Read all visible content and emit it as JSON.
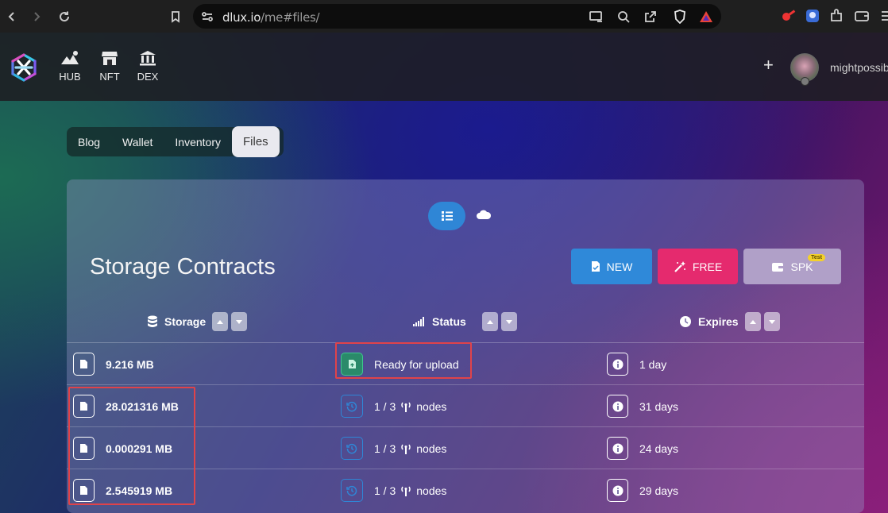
{
  "browser": {
    "url_host": "dlux.io",
    "url_path": "/me#files/"
  },
  "header": {
    "nav": [
      {
        "label": "HUB",
        "icon": "mountain-icon"
      },
      {
        "label": "NFT",
        "icon": "store-icon"
      },
      {
        "label": "DEX",
        "icon": "bank-icon"
      }
    ],
    "username": "mightpossibl"
  },
  "tabs": [
    {
      "label": "Blog",
      "active": false
    },
    {
      "label": "Wallet",
      "active": false
    },
    {
      "label": "Inventory",
      "active": false
    },
    {
      "label": "Files",
      "active": true
    }
  ],
  "card": {
    "title": "Storage Contracts",
    "buttons": {
      "new": "NEW",
      "free": "FREE",
      "spk": "SPK",
      "spk_badge": "Test"
    },
    "columns": {
      "storage": "Storage",
      "status": "Status",
      "expires": "Expires"
    },
    "rows": [
      {
        "size": "9.216 MB",
        "status": "Ready for upload",
        "nodes_count": "",
        "nodes_label": "",
        "expires": "1 day"
      },
      {
        "size": "28.021316 MB",
        "status": "",
        "nodes_count": "1 / 3",
        "nodes_label": "nodes",
        "expires": "31 days"
      },
      {
        "size": "0.000291 MB",
        "status": "",
        "nodes_count": "1 / 3",
        "nodes_label": "nodes",
        "expires": "24 days"
      },
      {
        "size": "2.545919 MB",
        "status": "",
        "nodes_count": "1 / 3",
        "nodes_label": "nodes",
        "expires": "29 days"
      }
    ]
  },
  "colors": {
    "accent_blue": "#2f86d6",
    "accent_pink": "#e52a6e",
    "spk_purple": "#b0a0c8",
    "highlight_red": "#e0434a",
    "upload_green": "#3ec78d"
  }
}
